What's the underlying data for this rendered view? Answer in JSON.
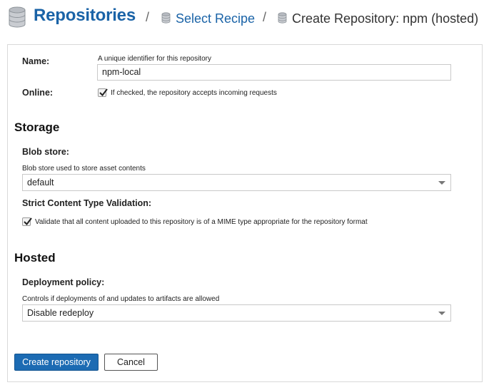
{
  "header": {
    "title": "Repositories",
    "separator": "/",
    "crumb_select_recipe": "Select Recipe",
    "crumb_current": "Create Repository: npm (hosted)"
  },
  "form": {
    "name": {
      "label": "Name:",
      "help": "A unique identifier for this repository",
      "value": "npm-local"
    },
    "online": {
      "label": "Online:",
      "checked": true,
      "checkbox_label": "If checked, the repository accepts incoming requests"
    }
  },
  "storage": {
    "section_title": "Storage",
    "blob_store": {
      "label": "Blob store:",
      "help": "Blob store used to store asset contents",
      "selected": "default"
    },
    "strict_validation": {
      "label": "Strict Content Type Validation:",
      "checked": true,
      "checkbox_label": "Validate that all content uploaded to this repository is of a MIME type appropriate for the repository format"
    }
  },
  "hosted": {
    "section_title": "Hosted",
    "deployment_policy": {
      "label": "Deployment policy:",
      "help": "Controls if deployments of and updates to artifacts are allowed",
      "selected": "Disable redeploy"
    }
  },
  "actions": {
    "create_label": "Create repository",
    "cancel_label": "Cancel"
  },
  "colors": {
    "link": "#1a63a7",
    "primary_button": "#1c6bb3",
    "icon": "#9aa0a6"
  },
  "icons": {
    "header": "database-icon",
    "crumb": "database-icon",
    "select": "chevron-down-icon",
    "check": "checkmark-icon"
  }
}
